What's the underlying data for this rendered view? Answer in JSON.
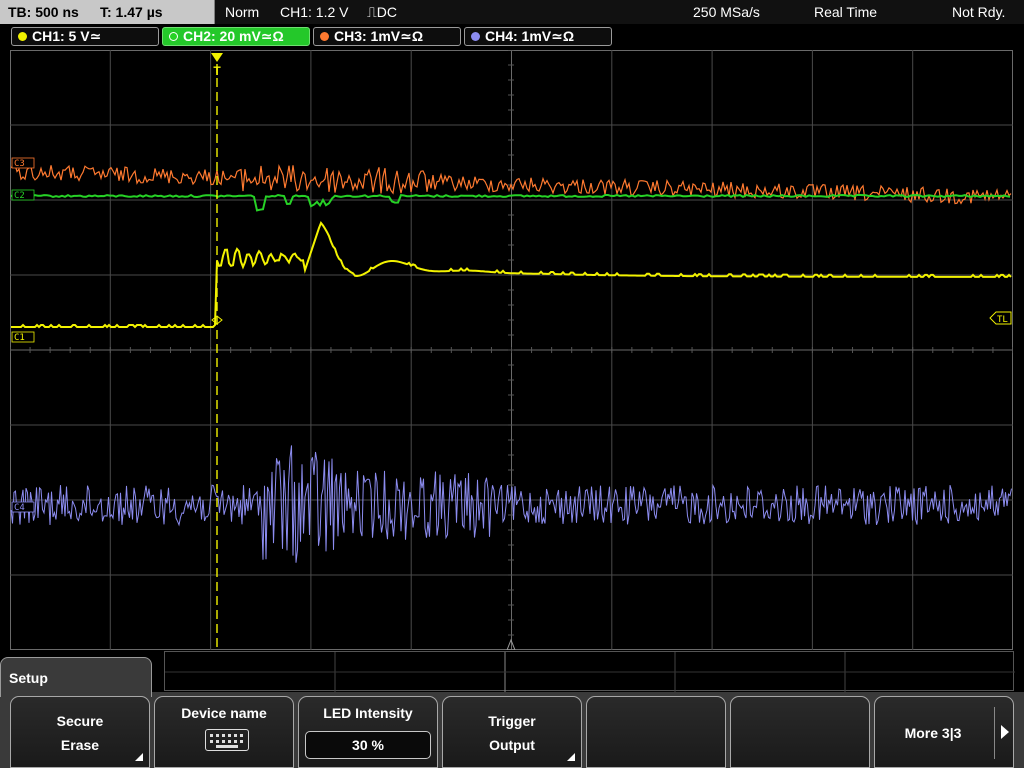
{
  "status": {
    "timebase": "TB: 500 ns",
    "trigger_time": "T: 1.47 µs",
    "mode": "Norm",
    "trigger_info": "CH1: 1.2 V",
    "trigger_slope_coupling": "⎍DC",
    "sample_rate": "250 MSa/s",
    "acquisition": "Real Time",
    "ready_state": "Not Rdy."
  },
  "channels": [
    {
      "label": "CH1: 5 V≃",
      "color": "#f2f200",
      "active": false
    },
    {
      "label": "CH2: 20 mV≃Ω",
      "color": "#26d226",
      "active": true
    },
    {
      "label": "CH3: 1mV≃Ω",
      "color": "#ff7a30",
      "active": false
    },
    {
      "label": "CH4: 1mV≃Ω",
      "color": "#8c8cf0",
      "active": false
    }
  ],
  "markers": {
    "ch1_ref": "C1",
    "ch2_ref": "C2",
    "ch3_ref": "C3",
    "ch4_ref": "C4",
    "trigger_level": "TL",
    "trigger_position": "T"
  },
  "setup_tab": "Setup",
  "softkeys": {
    "secure_erase": {
      "line1": "Secure",
      "line2": "Erase"
    },
    "device_name": {
      "label": "Device name",
      "icon": "keyboard-icon"
    },
    "led_intensity": {
      "label": "LED Intensity",
      "value": "30 %"
    },
    "trigger_output": {
      "line1": "Trigger",
      "line2": "Output"
    },
    "more": {
      "label": "More 3|3"
    }
  },
  "colors": {
    "ch1": "#f2f200",
    "ch2": "#26d226",
    "ch3": "#ff7a30",
    "ch4": "#8c8cf0",
    "grid": "#4a4a4a"
  }
}
